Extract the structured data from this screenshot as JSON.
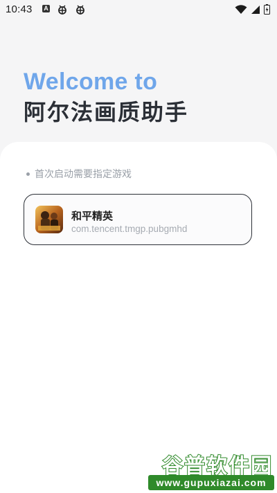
{
  "status_bar": {
    "time": "10:43",
    "left_icons": [
      "a-icon",
      "bug-icon",
      "bug-icon"
    ],
    "right_icons": [
      "wifi-icon",
      "signal-icon",
      "battery-charging-icon"
    ]
  },
  "header": {
    "welcome": "Welcome to",
    "app_name": "阿尔法画质助手"
  },
  "main": {
    "hint": "首次启动需要指定游戏",
    "game": {
      "title": "和平精英",
      "package": "com.tencent.tmgp.pubgmhd",
      "icon": "game-icon"
    }
  },
  "watermark": {
    "text": "谷普软件园",
    "url": "www.gupuxiazai.com"
  },
  "colors": {
    "accent": "#6fa6ea",
    "title": "#2b2f36",
    "muted": "#9aa0a8",
    "watermark_green": "#2f8a2a"
  }
}
